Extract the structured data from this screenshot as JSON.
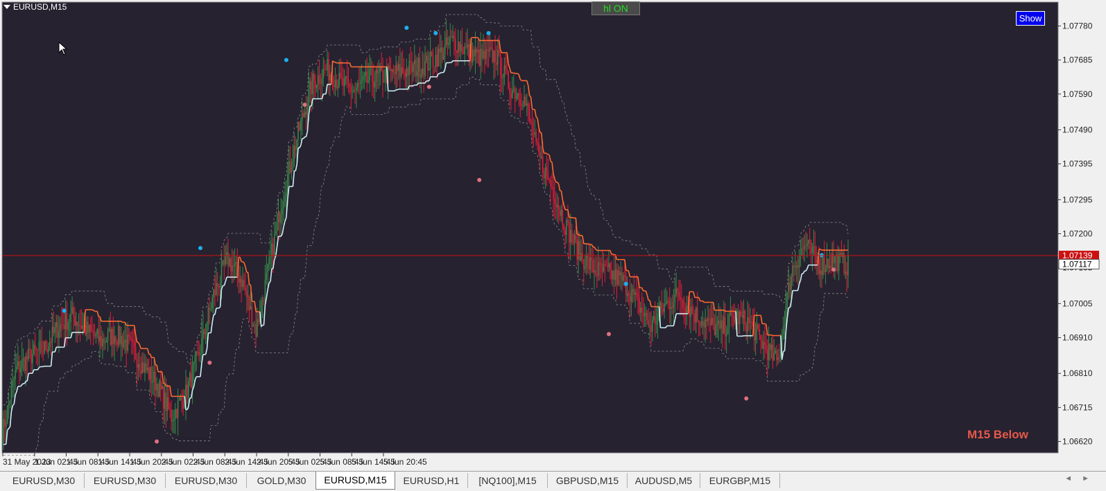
{
  "window": {
    "symbol_label": "EURUSD,M15",
    "hl_button": "hl ON",
    "show_button": "Show",
    "bottom_label": "M15 Below"
  },
  "colors": {
    "background": "#262230",
    "bull": "#3a8a4a",
    "bear": "#e0203a",
    "trail_up": "#cfeef6",
    "trail_down": "#ff6a30",
    "band": "#8a8a8a",
    "high_dot": "#1cb0f0",
    "low_dot": "#e07080",
    "price_line": "#cc1111"
  },
  "chart_data": {
    "type": "candlestick",
    "symbol": "EURUSD",
    "timeframe": "M15",
    "ylim": [
      1.0658,
      1.0785
    ],
    "y_ticks": [
      "1.07780",
      "1.07685",
      "1.07590",
      "1.07490",
      "1.07395",
      "1.07295",
      "1.07200",
      "1.07105",
      "1.07005",
      "1.06910",
      "1.06810",
      "1.06715",
      "1.06620"
    ],
    "x_ticks": [
      "31 May 2023",
      "1 Jun 02:45",
      "1 Jun 08:45",
      "1 Jun 14:45",
      "1 Jun 20:45",
      "2 Jun 02:45",
      "2 Jun 08:45",
      "2 Jun 14:45",
      "2 Jun 20:45",
      "5 Jun 02:45",
      "5 Jun 08:45",
      "5 Jun 14:45",
      "5 Jun 20:45"
    ],
    "bid_price": "1.07139",
    "ask_price": "1.07117",
    "close_path": [
      1.0664,
      1.0682,
      1.0686,
      1.0688,
      1.0694,
      1.0697,
      1.0693,
      1.069,
      1.0692,
      1.0689,
      1.0683,
      1.0678,
      1.0669,
      1.0675,
      1.0687,
      1.0703,
      1.0713,
      1.0707,
      1.0693,
      1.0712,
      1.0732,
      1.0748,
      1.0762,
      1.0766,
      1.0762,
      1.076,
      1.0763,
      1.0764,
      1.0765,
      1.0766,
      1.0767,
      1.077,
      1.0774,
      1.0771,
      1.0769,
      1.077,
      1.0761,
      1.0758,
      1.0742,
      1.0733,
      1.0722,
      1.0714,
      1.071,
      1.0709,
      1.0707,
      1.0701,
      1.0694,
      1.07,
      1.0703,
      1.0698,
      1.0695,
      1.0693,
      1.0697,
      1.0695,
      1.0689,
      1.0684,
      1.071,
      1.0717,
      1.0711,
      1.0713,
      1.0711
    ],
    "swing_highs": [
      [
        46,
        1.06985
      ],
      [
        149,
        1.0716
      ],
      [
        214,
        1.07685
      ],
      [
        305,
        1.07775
      ],
      [
        327,
        1.0776
      ],
      [
        367,
        1.0776
      ],
      [
        471,
        1.0706
      ],
      [
        619,
        1.0714
      ]
    ],
    "swing_lows": [
      [
        116,
        1.0662
      ],
      [
        156,
        1.0684
      ],
      [
        228,
        1.0756
      ],
      [
        322,
        1.0761
      ],
      [
        360,
        1.0735
      ],
      [
        458,
        1.0692
      ],
      [
        562,
        1.0674
      ],
      [
        628,
        1.071
      ]
    ]
  }
}
